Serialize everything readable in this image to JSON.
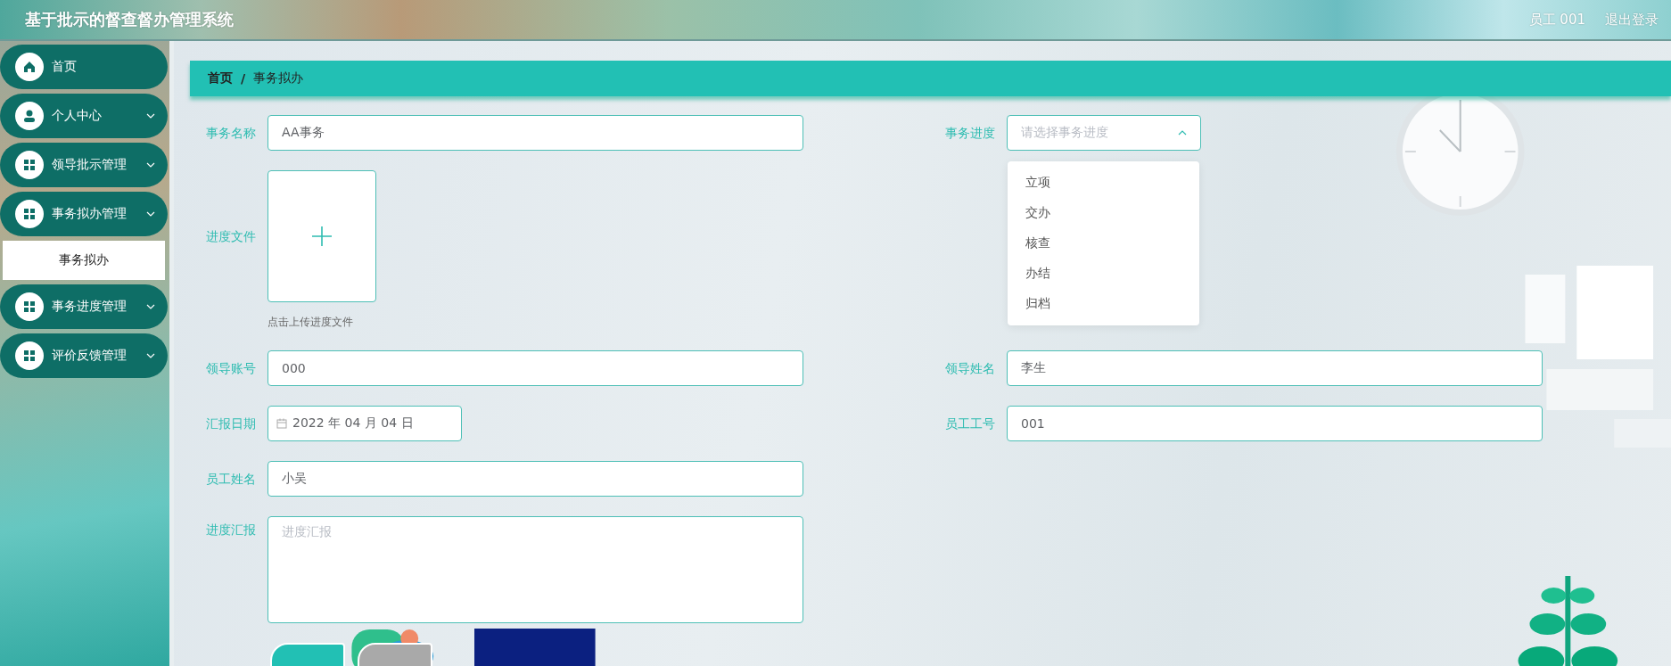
{
  "header": {
    "title": "基于批示的督查督办管理系统",
    "user": "员工 001",
    "logout": "退出登录"
  },
  "sidebar": {
    "items": [
      {
        "label": "首页",
        "kind": "home",
        "collapsible": false
      },
      {
        "label": "个人中心",
        "kind": "user",
        "collapsible": true
      },
      {
        "label": "领导批示管理",
        "kind": "grid",
        "collapsible": true
      },
      {
        "label": "事务拟办管理",
        "kind": "grid",
        "collapsible": true,
        "children": [
          {
            "label": "事务拟办",
            "selected": true
          }
        ]
      },
      {
        "label": "事务进度管理",
        "kind": "grid",
        "collapsible": true
      },
      {
        "label": "评价反馈管理",
        "kind": "grid",
        "collapsible": true
      }
    ]
  },
  "breadcrumb": {
    "items": [
      "首页",
      "事务拟办"
    ],
    "separator": "/"
  },
  "form": {
    "rows": [
      {
        "left": {
          "kind": "text",
          "label": "事务名称",
          "value": "AA事务"
        },
        "right": {
          "kind": "select",
          "label": "事务进度",
          "placeholder": "请选择事务进度",
          "expanded": true,
          "options": [
            {
              "label": "立项",
              "selected": false
            },
            {
              "label": "交办",
              "selected": false
            },
            {
              "label": "核查",
              "selected": false
            },
            {
              "label": "办结",
              "selected": false
            },
            {
              "label": "归档",
              "selected": false
            }
          ]
        }
      },
      {
        "left": {
          "kind": "upload",
          "label": "进度文件",
          "hint": "点击上传进度文件"
        }
      },
      {
        "left": {
          "kind": "text",
          "label": "领导账号",
          "value": "000"
        },
        "right": {
          "kind": "text",
          "label": "领导姓名",
          "value": "李生"
        }
      },
      {
        "left": {
          "kind": "date",
          "label": "汇报日期",
          "value": "2022 年 04 月 04 日"
        },
        "right": {
          "kind": "text",
          "label": "员工工号",
          "value": "001"
        }
      },
      {
        "left": {
          "kind": "text",
          "label": "员工姓名",
          "value": "小吴"
        }
      },
      {
        "left": {
          "kind": "textarea",
          "label": "进度汇报",
          "placeholder": "进度汇报"
        }
      }
    ],
    "buttons": [
      {
        "kind": "primary"
      },
      {
        "kind": "cancel"
      }
    ]
  }
}
